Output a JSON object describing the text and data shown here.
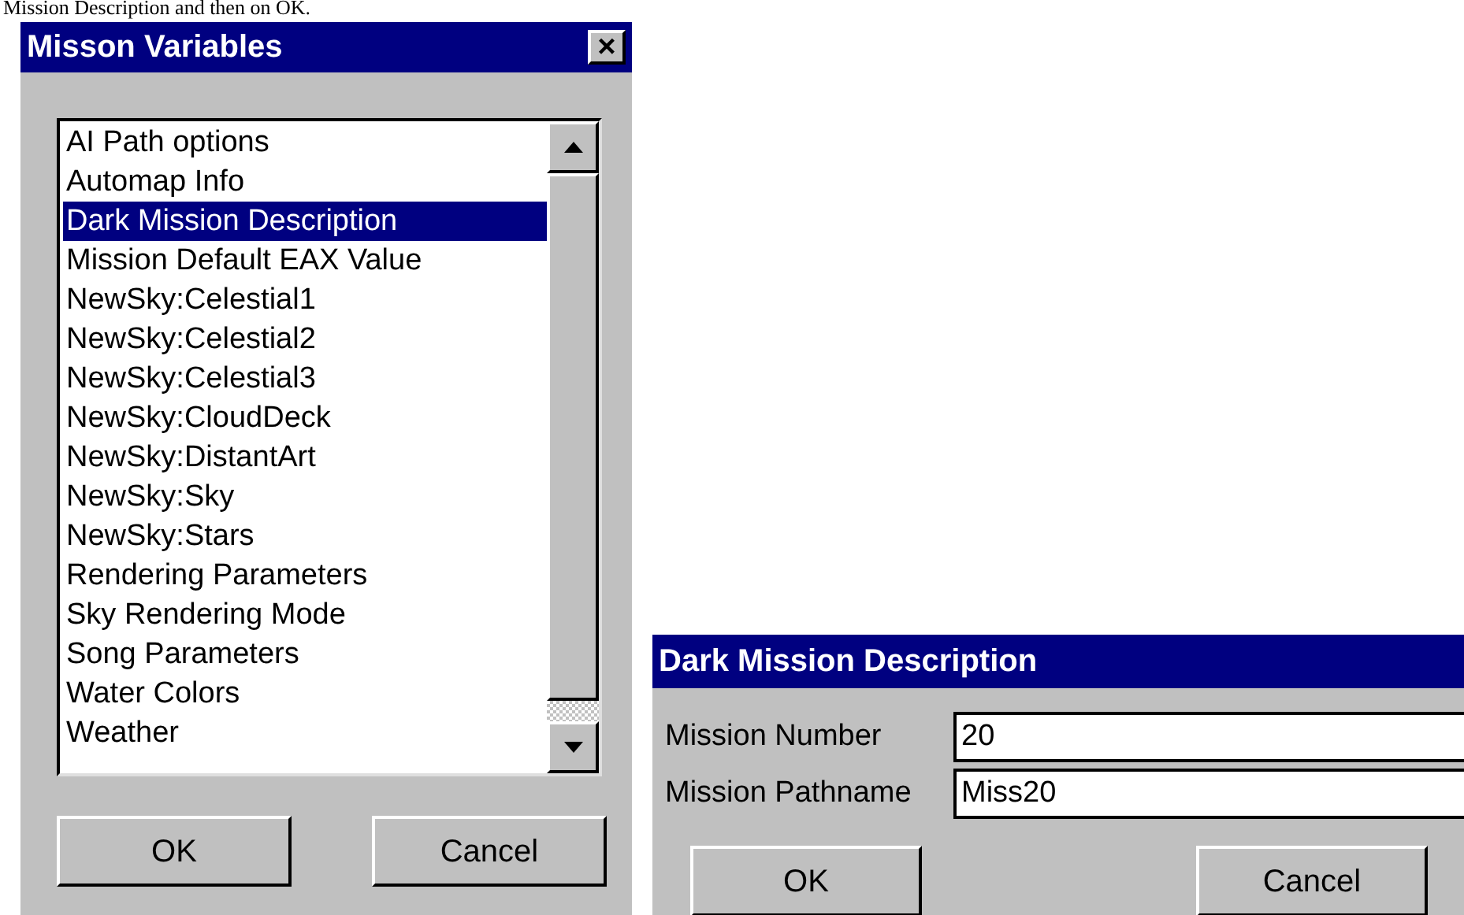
{
  "doc_text": "Mission Description and then on OK.",
  "variables_dialog": {
    "title": "Misson Variables",
    "close": "×",
    "items": [
      {
        "label": "AI Path options",
        "selected": false
      },
      {
        "label": "Automap Info",
        "selected": false
      },
      {
        "label": "Dark Mission Description",
        "selected": true
      },
      {
        "label": "Mission Default EAX Value",
        "selected": false
      },
      {
        "label": "NewSky:Celestial1",
        "selected": false
      },
      {
        "label": "NewSky:Celestial2",
        "selected": false
      },
      {
        "label": "NewSky:Celestial3",
        "selected": false
      },
      {
        "label": "NewSky:CloudDeck",
        "selected": false
      },
      {
        "label": "NewSky:DistantArt",
        "selected": false
      },
      {
        "label": "NewSky:Sky",
        "selected": false
      },
      {
        "label": "NewSky:Stars",
        "selected": false
      },
      {
        "label": "Rendering Parameters",
        "selected": false
      },
      {
        "label": "Sky Rendering Mode",
        "selected": false
      },
      {
        "label": "Song Parameters",
        "selected": false
      },
      {
        "label": "Water Colors",
        "selected": false
      },
      {
        "label": "Weather",
        "selected": false
      }
    ],
    "buttons": [
      "OK",
      "Cancel"
    ]
  },
  "description_dialog": {
    "title": "Dark Mission Description",
    "fields": [
      {
        "label": "Mission Number",
        "value": "20"
      },
      {
        "label": "Mission Pathname",
        "value": "Miss20"
      }
    ],
    "buttons": [
      "OK",
      "Cancel"
    ]
  }
}
